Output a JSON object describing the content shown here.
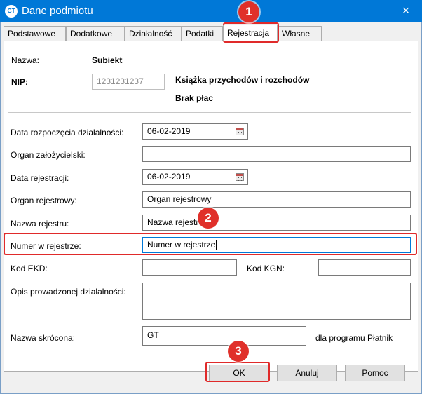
{
  "window": {
    "app_icon": "GT",
    "title": "Dane podmiotu",
    "close_icon": "×"
  },
  "tabs": [
    {
      "label": "Podstawowe",
      "active": false
    },
    {
      "label": "Dodatkowe",
      "active": false
    },
    {
      "label": "Działalność",
      "active": false
    },
    {
      "label": "Podatki",
      "active": false
    },
    {
      "label": "Rejestracja",
      "active": true
    },
    {
      "label": "Własne",
      "active": false
    }
  ],
  "header": {
    "nazwa_label": "Nazwa:",
    "nazwa_value": "Subiekt",
    "nip_label": "NIP:",
    "nip_value": "1231231237",
    "ksiegowosc": "Książka przychodów i rozchodów",
    "place": "Brak płac"
  },
  "form": {
    "data_rozpoczecia": {
      "label": "Data rozpoczęcia działalności:",
      "value": "06-02-2019"
    },
    "organ_zalozycielski": {
      "label": "Organ założycielski:",
      "value": ""
    },
    "data_rejestracji": {
      "label": "Data rejestracji:",
      "value": "06-02-2019"
    },
    "organ_rejestrowy": {
      "label": "Organ rejestrowy:",
      "value": "Organ rejestrowy"
    },
    "nazwa_rejestru": {
      "label": "Nazwa rejestru:",
      "value": "Nazwa rejestru"
    },
    "numer_w_rejestrze": {
      "label": "Numer w rejestrze:",
      "value": "Numer w rejestrze"
    },
    "kod_ekd": {
      "label": "Kod EKD:",
      "value": ""
    },
    "kod_kgn": {
      "label": "Kod KGN:",
      "value": ""
    },
    "opis": {
      "label": "Opis prowadzonej działalności:",
      "value": ""
    },
    "nazwa_skrocona": {
      "label": "Nazwa skrócona:",
      "value": "GT"
    },
    "platnik_note": "dla programu Płatnik"
  },
  "buttons": {
    "ok": "OK",
    "anuluj": "Anuluj",
    "pomoc": "Pomoc"
  },
  "callouts": {
    "one": "1",
    "two": "2",
    "three": "3"
  },
  "colors": {
    "titlebar": "#0078d7",
    "highlight": "#e02a2a",
    "badge": "#e0302a"
  }
}
